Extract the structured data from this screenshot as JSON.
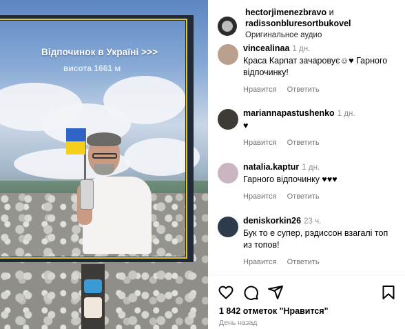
{
  "video": {
    "billboard_title": "Відпочинок в Україні >>>",
    "billboard_subtitle": "висота 1661 м",
    "flag_colors": [
      "#2f63c5",
      "#f5d01a"
    ]
  },
  "header": {
    "user1": "hectorjimenezbravo",
    "connector": " и",
    "user2": "radissonbluresortbukovel",
    "audio": "Оригинальное аудио"
  },
  "comments": [
    {
      "username": "vincealinaa",
      "time": "1 дн.",
      "text": "Краса Карпат зачаровує☺♥ Гарного відпочинку!",
      "like_label": "Нравится",
      "reply_label": "Ответить",
      "avatar_color": "#b9a08e"
    },
    {
      "username": "mariannapastushenko",
      "time": "1 дн.",
      "text": "♥",
      "like_label": "Нравится",
      "reply_label": "Ответить",
      "avatar_color": "#3e3a35"
    },
    {
      "username": "natalia.kaptur",
      "time": "1 дн.",
      "text": "Гарного відпочинку ♥♥♥",
      "like_label": "Нравится",
      "reply_label": "Ответить",
      "avatar_color": "#c9b6c1"
    },
    {
      "username": "deniskorkin26",
      "time": "23 ч.",
      "text": "Бук то е супер, рэдиссон взагалі топ из топов!",
      "like_label": "Нравится",
      "reply_label": "Ответить",
      "avatar_color": "#2d3b4d"
    }
  ],
  "actions": {
    "icons": [
      "heart-icon",
      "comment-icon",
      "share-icon",
      "bookmark-icon"
    ]
  },
  "likes_text": "1 842 отметок \"Нравится\"",
  "date_text": "День назад"
}
